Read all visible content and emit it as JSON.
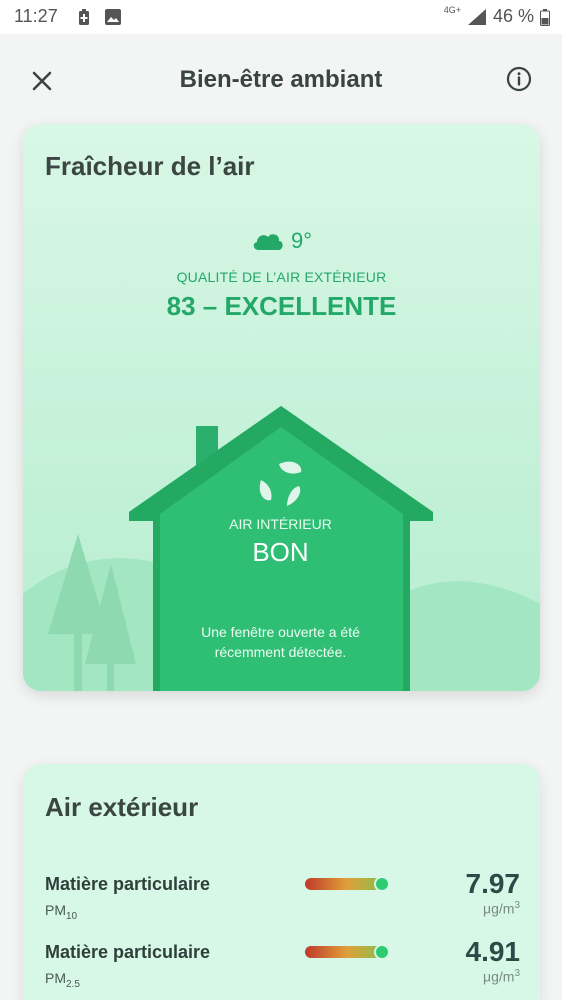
{
  "status_bar": {
    "time": "11:27",
    "network": "4G+",
    "battery": "46 %",
    "icons": [
      "battery-saver-icon",
      "image-icon",
      "signal-icon",
      "battery-icon"
    ]
  },
  "app_bar": {
    "title": "Bien-être ambiant",
    "icons": [
      "close-icon",
      "info-icon"
    ]
  },
  "freshness": {
    "title": "Fraîcheur de l’air",
    "temperature": "9°",
    "outdoor_label": "QUALITÉ DE L’AIR EXTÉRIEUR",
    "outdoor_value": "83 – EXCELLENTE",
    "indoor_label": "AIR INTÉRIEUR",
    "indoor_value": "BON",
    "note_line1": "Une fenêtre ouverte a été",
    "note_line2": "récemment détectée.",
    "colors": {
      "accent": "#23a868",
      "house": "#2fbf74",
      "card_bg": "#d9f7e6"
    }
  },
  "outdoor": {
    "title": "Air extérieur",
    "metrics": [
      {
        "name": "Matière particulaire",
        "sub": "PM",
        "sub_index": "10",
        "value": "7.97",
        "unit": "μg/m",
        "unit_exp": "3",
        "level": 0.92
      },
      {
        "name": "Matière particulaire",
        "sub": "PM",
        "sub_index": "2.5",
        "value": "4.91",
        "unit": "μg/m",
        "unit_exp": "3",
        "level": 0.92
      }
    ]
  }
}
